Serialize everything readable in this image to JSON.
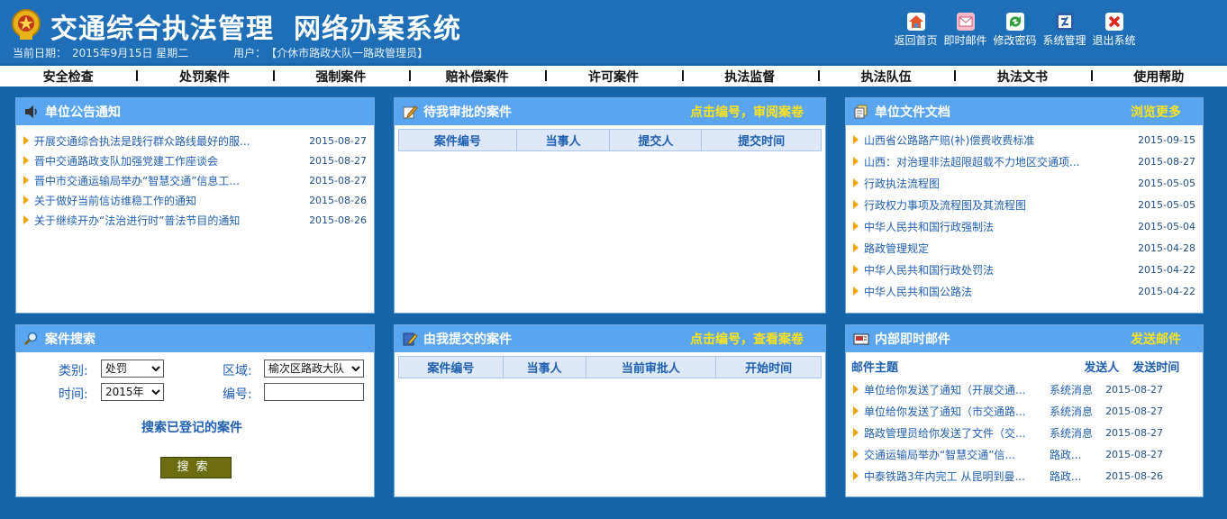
{
  "header": {
    "title_part1": "交通综合执法管理",
    "title_part2": "网络办案系统",
    "date_label": "当前日期：",
    "date_value": "2015年9月15日  星期二",
    "user_label": "用户：",
    "user_value": "【介休市路政大队一路政管理员】"
  },
  "toolbar": {
    "home": "返回首页",
    "mail": "即时邮件",
    "password": "修改密码",
    "system": "系统管理",
    "exit": "退出系统"
  },
  "nav": [
    "安全检查",
    "处罚案件",
    "强制案件",
    "赔补偿案件",
    "许可案件",
    "执法监督",
    "执法队伍",
    "执法文书",
    "使用帮助"
  ],
  "notices": {
    "title": "单位公告通知",
    "items": [
      {
        "text": "开展交通综合执法是践行群众路线最好的服...",
        "date": "2015-08-27"
      },
      {
        "text": "晋中交通路政支队加强党建工作座谈会",
        "date": "2015-08-27"
      },
      {
        "text": "晋中市交通运输局举办“智慧交通”信息工...",
        "date": "2015-08-27"
      },
      {
        "text": "关于做好当前信访维稳工作的通知",
        "date": "2015-08-26"
      },
      {
        "text": "关于继续开办“法治进行时”普法节目的通知",
        "date": "2015-08-26"
      }
    ]
  },
  "pending": {
    "title": "待我审批的案件",
    "link": "点击编号，审阅案卷",
    "columns": [
      "案件编号",
      "当事人",
      "提交人",
      "提交时间"
    ]
  },
  "documents": {
    "title": "单位文件文档",
    "link": "浏览更多",
    "items": [
      {
        "text": "山西省公路路产赔(补)偿费收费标准",
        "date": "2015-09-15"
      },
      {
        "text": "山西：对治理非法超限超载不力地区交通项...",
        "date": "2015-08-27"
      },
      {
        "text": "行政执法流程图",
        "date": "2015-05-05"
      },
      {
        "text": "行政权力事项及流程图及其流程图",
        "date": "2015-05-05"
      },
      {
        "text": "中华人民共和国行政强制法",
        "date": "2015-05-04"
      },
      {
        "text": "路政管理规定",
        "date": "2015-04-28"
      },
      {
        "text": "中华人民共和国行政处罚法",
        "date": "2015-04-22"
      },
      {
        "text": "中华人民共和国公路法",
        "date": "2015-04-22"
      }
    ]
  },
  "search": {
    "title": "案件搜索",
    "type_label": "类别:",
    "type_value": "处罚",
    "region_label": "区域:",
    "region_value": "榆次区路政大队",
    "time_label": "时间:",
    "time_value": "2015年",
    "number_label": "编号:",
    "number_value": "",
    "link": "搜索已登记的案件",
    "button": "搜索"
  },
  "submitted": {
    "title": "由我提交的案件",
    "link": "点击编号，查看案卷",
    "columns": [
      "案件编号",
      "当事人",
      "当前审批人",
      "开始时间"
    ]
  },
  "mail": {
    "title": "内部即时邮件",
    "link": "发送邮件",
    "col_subject": "邮件主题",
    "col_sender": "发送人",
    "col_time": "发送时间",
    "items": [
      {
        "subject": "单位给你发送了通知（开展交通...",
        "sender": "系统消息",
        "date": "2015-08-27"
      },
      {
        "subject": "单位给你发送了通知（市交通路...",
        "sender": "系统消息",
        "date": "2015-08-27"
      },
      {
        "subject": "路政管理员给你发送了文件（交...",
        "sender": "系统消息",
        "date": "2015-08-27"
      },
      {
        "subject": "交通运输局举办“智慧交通”信...",
        "sender": "路政...",
        "date": "2015-08-27"
      },
      {
        "subject": "中泰铁路3年内完工 从昆明到曼...",
        "sender": "路政...",
        "date": "2015-08-26"
      }
    ]
  },
  "colors": {
    "background": "#1565a8",
    "panel_header": "#5aa5ef",
    "link_yellow": "#ffe31a",
    "arrow_orange": "#f3a20c"
  }
}
